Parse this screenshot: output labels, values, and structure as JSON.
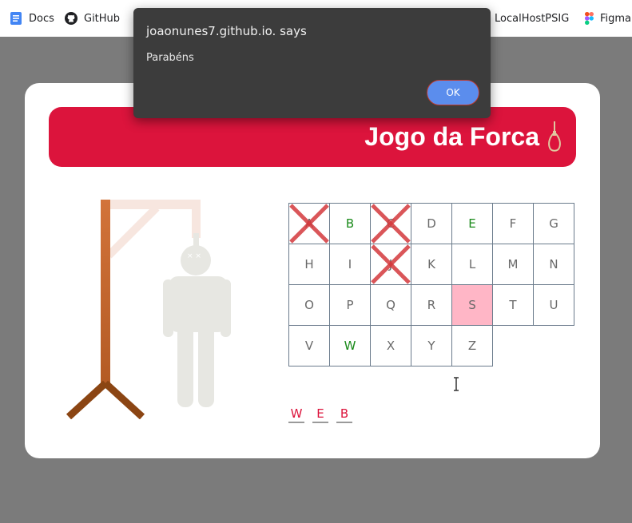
{
  "bookmarks": {
    "items": [
      {
        "label": "Docs",
        "icon": "docs-icon"
      },
      {
        "label": "GitHub",
        "icon": "github-icon"
      },
      {
        "label": "LocalHostPSIG",
        "icon": "localhost-icon"
      },
      {
        "label": "Figma",
        "icon": "figma-icon"
      }
    ]
  },
  "game": {
    "title": "Jogo da Forca",
    "accent_color": "#dc143c",
    "highlight_color": "#ffb6c6",
    "keys": [
      {
        "letter": "A",
        "state": "wrong"
      },
      {
        "letter": "B",
        "state": "correct"
      },
      {
        "letter": "C",
        "state": "wrong"
      },
      {
        "letter": "D",
        "state": "unused"
      },
      {
        "letter": "E",
        "state": "correct"
      },
      {
        "letter": "F",
        "state": "unused"
      },
      {
        "letter": "G",
        "state": "unused"
      },
      {
        "letter": "H",
        "state": "unused"
      },
      {
        "letter": "I",
        "state": "unused"
      },
      {
        "letter": "J",
        "state": "wrong"
      },
      {
        "letter": "K",
        "state": "unused"
      },
      {
        "letter": "L",
        "state": "unused"
      },
      {
        "letter": "M",
        "state": "unused"
      },
      {
        "letter": "N",
        "state": "unused"
      },
      {
        "letter": "O",
        "state": "unused"
      },
      {
        "letter": "P",
        "state": "unused"
      },
      {
        "letter": "Q",
        "state": "unused"
      },
      {
        "letter": "R",
        "state": "unused"
      },
      {
        "letter": "S",
        "state": "highlighted"
      },
      {
        "letter": "T",
        "state": "unused"
      },
      {
        "letter": "U",
        "state": "unused"
      },
      {
        "letter": "V",
        "state": "unused"
      },
      {
        "letter": "W",
        "state": "correct"
      },
      {
        "letter": "X",
        "state": "unused"
      },
      {
        "letter": "Y",
        "state": "unused"
      },
      {
        "letter": "Z",
        "state": "unused"
      }
    ],
    "word": [
      "W",
      "E",
      "B"
    ]
  },
  "dialog": {
    "title": "joaonunes7.github.io. says",
    "message": "Parabéns",
    "ok_label": "OK"
  }
}
